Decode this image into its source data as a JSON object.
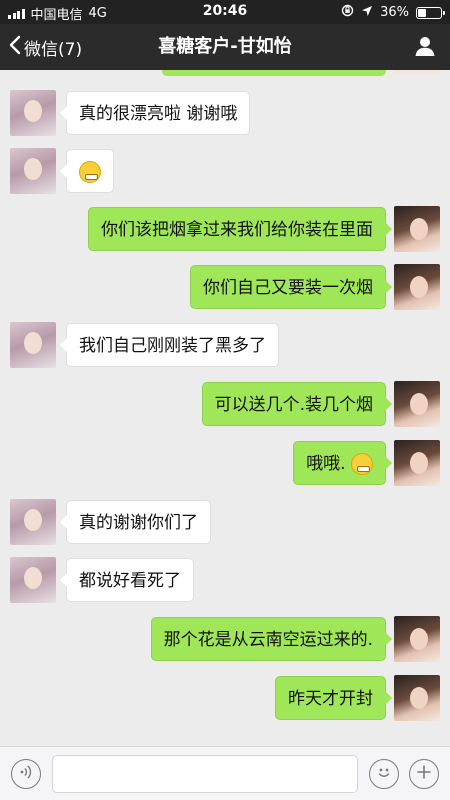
{
  "status_bar": {
    "carrier": "中国电信",
    "network": "4G",
    "time": "20:46",
    "battery": "36%",
    "battery_level": 0.36
  },
  "nav": {
    "back_label": "微信(7)",
    "title": "喜糖客户-甘如怡"
  },
  "messages": [
    {
      "side": "left",
      "text": "真的很漂亮啦  谢谢哦"
    },
    {
      "side": "left",
      "text": "",
      "emoji": "smirk-emoji"
    },
    {
      "side": "right",
      "text": "你们该把烟拿过来我们给你装在里面"
    },
    {
      "side": "right",
      "text": "你们自己又要装一次烟"
    },
    {
      "side": "left",
      "text": "我们自己刚刚装了黑多了"
    },
    {
      "side": "right",
      "text": "可以送几个.装几个烟"
    },
    {
      "side": "right",
      "text": "哦哦.",
      "emoji": "grin-emoji"
    },
    {
      "side": "left",
      "text": "真的谢谢你们了"
    },
    {
      "side": "left",
      "text": "都说好看死了"
    },
    {
      "side": "right",
      "text": "那个花是从云南空运过来的."
    },
    {
      "side": "right",
      "text": "昨天才开封"
    }
  ],
  "input": {
    "value": "",
    "placeholder": ""
  },
  "colors": {
    "sent_bubble": "#9fe658",
    "received_bubble": "#ffffff",
    "chat_background": "#ececec",
    "nav_background": "#2b2b2b"
  },
  "icons": {
    "voice": "voice-icon",
    "emoji": "emoji-icon",
    "add": "plus-icon",
    "profile": "profile-icon",
    "back": "chevron-left-icon"
  }
}
